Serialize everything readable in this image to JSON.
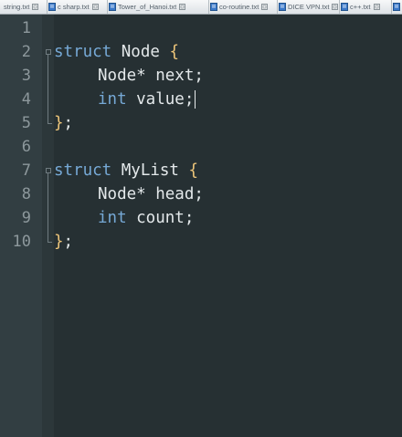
{
  "tabs": [
    {
      "label": "string.txt"
    },
    {
      "label": "c sharp.txt"
    },
    {
      "label": "Tower_of_Hanoi.txt"
    },
    {
      "label": "co-routine.txt"
    },
    {
      "label": "DICE VPN.txt"
    },
    {
      "label": "c++.txt"
    }
  ],
  "editor": {
    "line_numbers": [
      "1",
      "2",
      "3",
      "4",
      "5",
      "6",
      "7",
      "8",
      "9",
      "10"
    ],
    "lines": [
      {
        "tokens": []
      },
      {
        "tokens": [
          {
            "t": "struct",
            "k": "kw"
          },
          {
            "t": " Node ",
            "k": "id"
          },
          {
            "t": "{",
            "k": "brace"
          }
        ]
      },
      {
        "tokens": [
          {
            "t": "Node* next;",
            "k": "id"
          }
        ]
      },
      {
        "tokens": [
          {
            "t": "int",
            "k": "kw"
          },
          {
            "t": " value;",
            "k": "id"
          }
        ]
      },
      {
        "tokens": [
          {
            "t": "}",
            "k": "brace"
          },
          {
            "t": ";",
            "k": "punct"
          }
        ]
      },
      {
        "tokens": []
      },
      {
        "tokens": [
          {
            "t": "struct",
            "k": "kw"
          },
          {
            "t": " MyList ",
            "k": "id"
          },
          {
            "t": "{",
            "k": "brace"
          }
        ]
      },
      {
        "tokens": [
          {
            "t": "Node* head;",
            "k": "id"
          }
        ]
      },
      {
        "tokens": [
          {
            "t": "int",
            "k": "kw"
          },
          {
            "t": " count;",
            "k": "id"
          }
        ]
      },
      {
        "tokens": [
          {
            "t": "}",
            "k": "brace"
          },
          {
            "t": ";",
            "k": "punct"
          }
        ]
      }
    ],
    "cursor_line": 4
  },
  "colors": {
    "keyword": "#76a9d6",
    "identifier": "#e3e8ea",
    "brace": "#eec67a",
    "line_number": "#8d989c",
    "editor_background": "#263033",
    "gutter_background": "#323e42"
  },
  "icons": {
    "tab_icon": "text-file-icon",
    "tab_close": "close-icon"
  }
}
